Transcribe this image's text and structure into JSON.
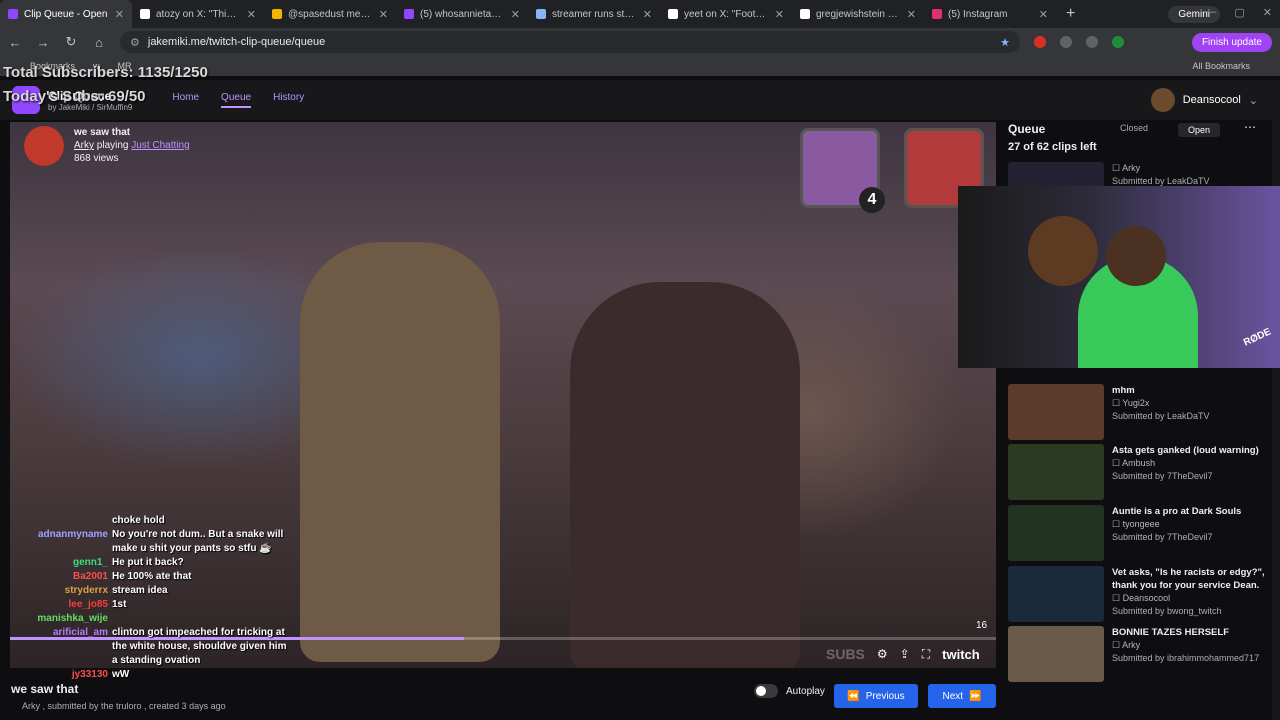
{
  "browser": {
    "tabs": [
      {
        "title": "Clip Queue - Open",
        "color": "#9147ff",
        "active": true
      },
      {
        "title": "atozy on X: \"This might",
        "color": "#000000"
      },
      {
        "title": "@spasedust mentio",
        "color": "#a142f4"
      },
      {
        "title": "(5) whosannietaboo - Tw",
        "color": "#9147ff"
      },
      {
        "title": "streamer runs stalker o",
        "color": "#5f6368"
      },
      {
        "title": "yeet on X: \"Footage of",
        "color": "#000000"
      },
      {
        "title": "gregjewishstein on X: \"I",
        "color": "#000000"
      },
      {
        "title": "(5) Instagram",
        "color": "#e1306c"
      }
    ],
    "gemini": "Gemini",
    "url": "jakemiki.me/twitch-clip-queue/queue",
    "finish_update": "Finish update",
    "bookmarks": [
      "Bookmarks",
      "w",
      "MR"
    ],
    "all_bookmarks": "All Bookmarks"
  },
  "overlay": {
    "total_subs": "Total Subscribers: 1135/1250",
    "today_subs": "Today's Subs: 69/50"
  },
  "site": {
    "brand": "Clip Queue",
    "by": "by",
    "authors": [
      "JakeMiki",
      "SirMuffin9"
    ],
    "nav": [
      "Home",
      "Queue",
      "History"
    ],
    "user": "Deansocool"
  },
  "player": {
    "clip_title": "we saw that",
    "channel": "Arky",
    "playing": "playing",
    "game": "Just Chatting",
    "views": "868 views",
    "thumb_badge": "4",
    "timer": "16",
    "progress": 0.46,
    "brand": "twitch",
    "subs_text": "SUBS"
  },
  "chat": [
    {
      "name": "",
      "msg": "choke hold",
      "color": "#8bd3dd"
    },
    {
      "name": "adnanmyname",
      "msg": "No you're not dum.. But a snake will make u shit your pants so stfu ☕",
      "color": "#a0a0ff"
    },
    {
      "name": "genn1_",
      "msg": "He put it back?",
      "color": "#3ddc84"
    },
    {
      "name": "Ba2001",
      "msg": "He 100% ate that",
      "color": "#ff4d4d"
    },
    {
      "name": "stryderrx",
      "msg": "stream idea",
      "color": "#e0a040"
    },
    {
      "name": "lee_jo85",
      "msg": "1st",
      "color": "#ff3b3b"
    },
    {
      "name": "manishka_wije",
      "msg": "",
      "color": "#66dd66"
    },
    {
      "name": "arificial_am",
      "msg": "clinton got impeached for tricking at the white house, shouldve given him a standing ovation",
      "color": "#b97aff"
    },
    {
      "name": "jy33130",
      "msg": "wW",
      "color": "#ff4d4d"
    }
  ],
  "below": {
    "title": "we saw that",
    "byline": "Arky , submitted by the truloro , created 3 days ago",
    "autoplay": "Autoplay",
    "previous": "Previous",
    "next": "Next"
  },
  "queue": {
    "title": "Queue",
    "closed": "Closed",
    "open": "Open",
    "count": "27 of 62 clips left",
    "items": [
      {
        "title": "",
        "channel": "Arky",
        "submitted": "Submitted by LeakDaTV",
        "color": "#222233"
      },
      {
        "title": "mhm",
        "channel": "Yugi2x",
        "submitted": "Submitted by LeakDaTV",
        "color": "#5a3a2a"
      },
      {
        "title": "Asta gets ganked (loud warning)",
        "channel": "Ambush",
        "submitted": "Submitted by 7TheDevil7",
        "color": "#2d3a22"
      },
      {
        "title": "Auntie is a pro at Dark Souls",
        "channel": "tyongeee",
        "submitted": "Submitted by 7TheDevil7",
        "color": "#223322"
      },
      {
        "title": "Vet asks, \"Is he racists or edgy?\", thank you for your service Dean.",
        "channel": "Deansocool",
        "submitted": "Submitted by bwong_twitch",
        "color": "#1a2a3a"
      },
      {
        "title": "BONNIE TAZES HERSELF",
        "channel": "Arky",
        "submitted": "Submitted by ibrahimmohammed717",
        "color": "#6a5a4a"
      }
    ]
  },
  "webcam": {
    "label": "RØDE"
  }
}
